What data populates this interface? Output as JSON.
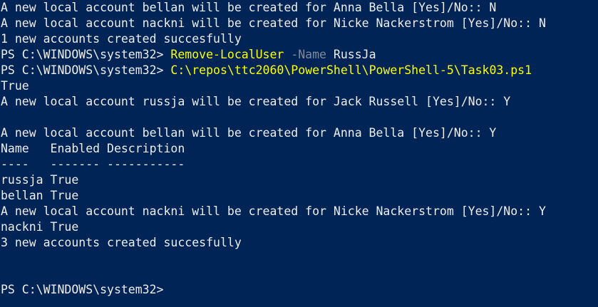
{
  "console": {
    "lines": [
      "A new local account bellan will be created for Anna Bella [Yes]/No:: N",
      "A new local account nackni will be created for Nicke Nackerstrom [Yes]/No:: N",
      "1 new accounts created succesfully",
      "",
      "",
      "True",
      "A new local account russja will be created for Jack Russell [Yes]/No:: Y",
      "",
      "A new local account bellan will be created for Anna Bella [Yes]/No:: Y",
      "Name   Enabled Description",
      "----   ------- -----------",
      "russja True",
      "bellan True",
      "A new local account nackni will be created for Nicke Nackerstrom [Yes]/No:: Y",
      "nackni True",
      "3 new accounts created succesfully",
      "",
      "",
      ""
    ],
    "prompt": "PS C:\\WINDOWS\\system32> ",
    "command1": {
      "cmdlet": "Remove-LocalUser",
      "param": "-Name",
      "arg": "RussJa"
    },
    "command2": {
      "script": "C:\\repos\\ttc2060\\PowerShell\\PowerShell-5\\Task03.ps1"
    },
    "colors": {
      "background": "#012456",
      "text": "#eeedf0",
      "command": "#ffff00",
      "parameter": "#7f8a9c"
    }
  }
}
